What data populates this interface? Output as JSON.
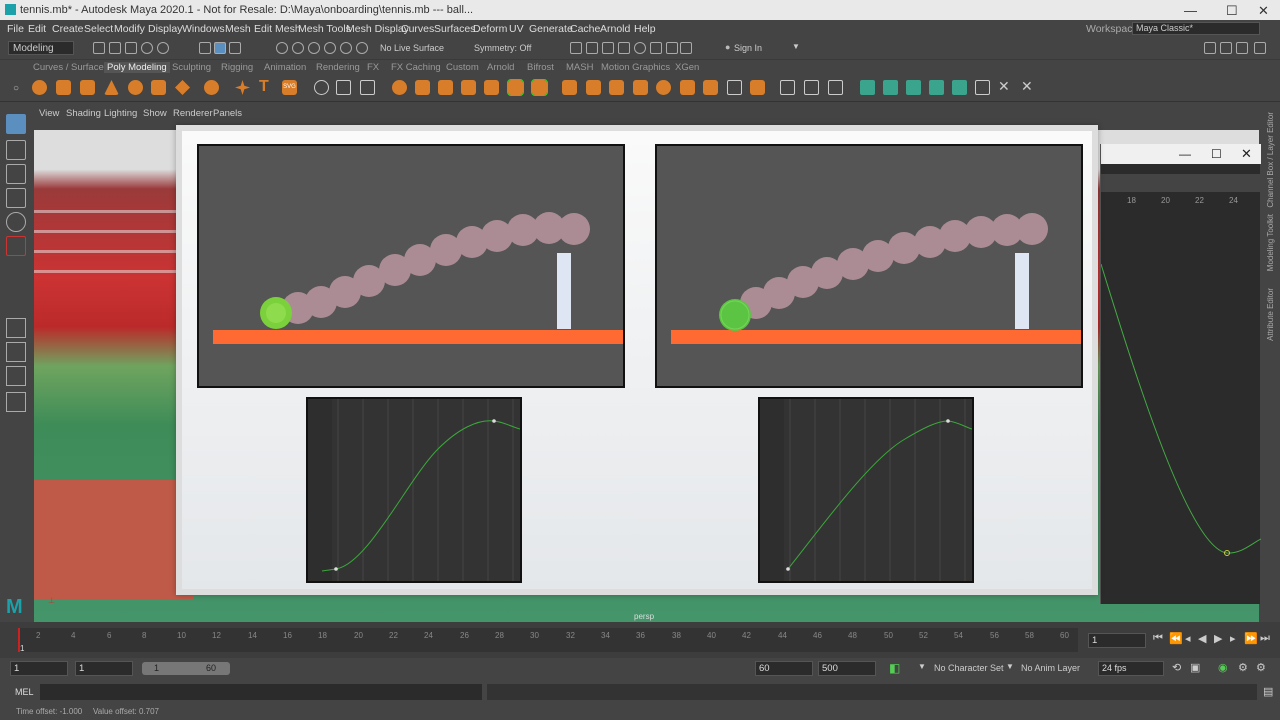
{
  "titlebar": {
    "title": "tennis.mb* - Autodesk Maya 2020.1 - Not for Resale: D:\\Maya\\onboarding\\tennis.mb  ---  ball...",
    "minimize": "—",
    "maximize": "☐",
    "close": "✕"
  },
  "menubar": {
    "items": [
      "File",
      "Edit",
      "Create",
      "Select",
      "Modify",
      "Display",
      "Windows",
      "Mesh",
      "Edit Mesh",
      "Mesh Tools",
      "Mesh Display",
      "Curves",
      "Surfaces",
      "Deform",
      "UV",
      "Generate",
      "Cache",
      "Arnold",
      "Help"
    ],
    "workspace_label": "Workspace :",
    "workspace_value": "Maya Classic*"
  },
  "statusline": {
    "menuset": "Modeling",
    "live_surface": "No Live Surface",
    "symmetry": "Symmetry: Off",
    "signin": "Sign In"
  },
  "shelf_tabs": [
    "Curves / Surfaces",
    "Poly Modeling",
    "Sculpting",
    "Rigging",
    "Animation",
    "Rendering",
    "FX",
    "FX Caching",
    "Custom",
    "Arnold",
    "Bifrost",
    "MASH",
    "Motion Graphics",
    "XGen"
  ],
  "shelf_active": "Poly Modeling",
  "viewport": {
    "menu": [
      "View",
      "Shading",
      "Lighting",
      "Show",
      "Renderer",
      "Panels"
    ],
    "camera_label": "persp"
  },
  "graph_window": {
    "ticks": [
      "18",
      "20",
      "22",
      "24"
    ]
  },
  "right_tabs": [
    "Channel Box / Layer Editor",
    "Modeling Toolkit",
    "Attribute Editor"
  ],
  "timeline": {
    "ticks": [
      "2",
      "4",
      "6",
      "8",
      "10",
      "12",
      "14",
      "16",
      "18",
      "20",
      "22",
      "24",
      "26",
      "28",
      "30",
      "32",
      "34",
      "36",
      "38",
      "40",
      "42",
      "44",
      "46",
      "48",
      "50",
      "52",
      "54",
      "56",
      "58",
      "60"
    ],
    "current_frame": "1",
    "start_marker": "1"
  },
  "range": {
    "start": "1",
    "inner_start": "1",
    "slider_start": "1",
    "slider_end": "60",
    "end": "60",
    "outer_end": "500",
    "character_set": "No Character Set",
    "anim_layer": "No Anim Layer",
    "fps": "24 fps"
  },
  "mel": {
    "label": "MEL"
  },
  "help": {
    "time_offset": "Time offset:   -1.000",
    "value_offset": "Value offset:   0.707"
  },
  "colors": {
    "accent_teal": "#1ba1a9",
    "curve": "#3ba83b",
    "ground": "#ff6a33",
    "ball_green": "#7bd13b",
    "ghost": "#b08f98"
  }
}
